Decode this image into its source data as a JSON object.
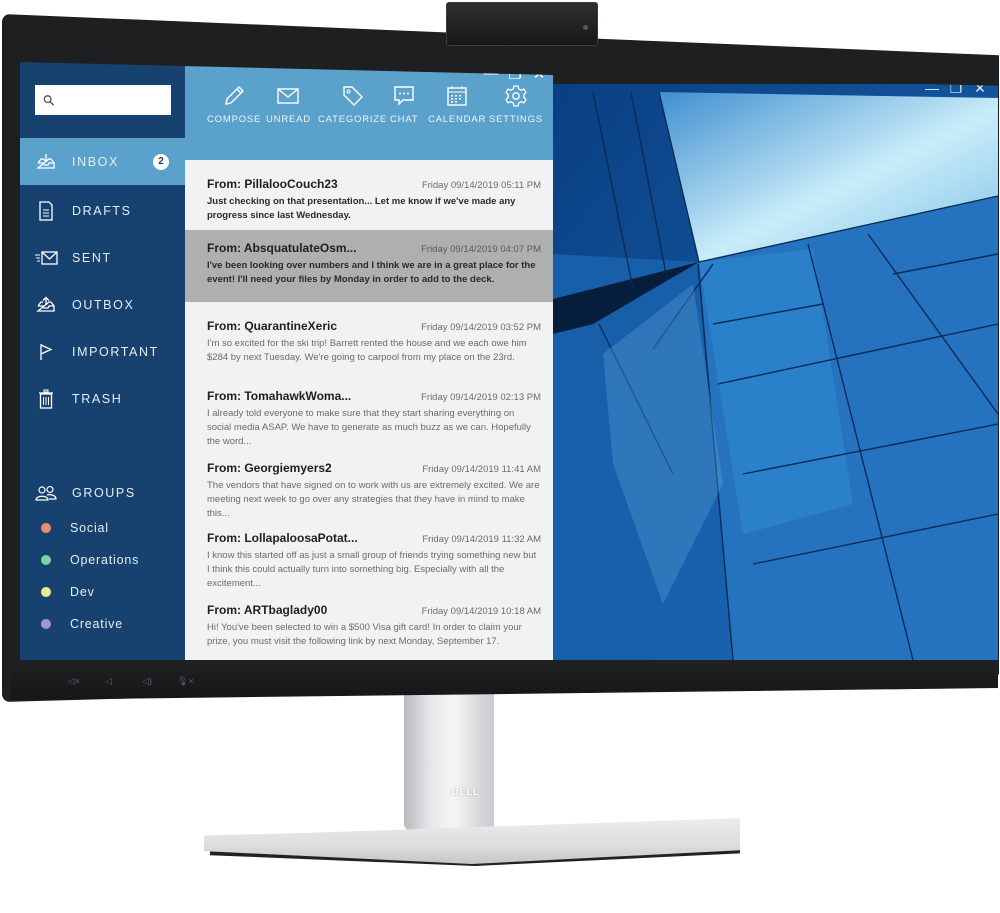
{
  "device": {
    "brand_logo": "DELL",
    "chin_buttons": [
      {
        "icon": "speaker-mute-icon",
        "glyph": "◁×"
      },
      {
        "icon": "speaker-low-icon",
        "glyph": "◁"
      },
      {
        "icon": "speaker-high-icon",
        "glyph": "◁)"
      },
      {
        "icon": "mic-mute-icon",
        "glyph": "🎙×"
      }
    ]
  },
  "mail_app": {
    "window_controls": {
      "minimize": "—",
      "restore": "❐",
      "close": "✕"
    },
    "search": {
      "placeholder": "",
      "value": "",
      "icon": "search-icon"
    },
    "nav": [
      {
        "label": "INBOX",
        "icon": "inbox-icon",
        "badge": "2",
        "active": true
      },
      {
        "label": "DRAFTS",
        "icon": "drafts-icon"
      },
      {
        "label": "SENT",
        "icon": "sent-icon"
      },
      {
        "label": "OUTBOX",
        "icon": "outbox-icon"
      },
      {
        "label": "IMPORTANT",
        "icon": "flag-icon"
      },
      {
        "label": "TRASH",
        "icon": "trash-icon"
      }
    ],
    "groups": {
      "label": "GROUPS",
      "icon": "groups-icon",
      "items": [
        {
          "label": "Social",
          "color": "#f08b74"
        },
        {
          "label": "Operations",
          "color": "#7ed0ac"
        },
        {
          "label": "Dev",
          "color": "#e8ec8a"
        },
        {
          "label": "Creative",
          "color": "#a393cf"
        }
      ]
    },
    "toolbar": [
      {
        "label": "COMPOSE",
        "icon": "pencil-icon"
      },
      {
        "label": "UNREAD",
        "icon": "envelope-icon"
      },
      {
        "label": "CATEGORIZE",
        "icon": "tag-icon"
      },
      {
        "label": "CHAT",
        "icon": "chat-icon"
      },
      {
        "label": "CALENDAR",
        "icon": "calendar-icon"
      },
      {
        "label": "SETTINGS",
        "icon": "gear-icon"
      }
    ],
    "messages": [
      {
        "from": "From: PillalooCouch23",
        "date": "Friday 09/14/2019 05:11 PM",
        "body": "Just checking on that presentation... Let me know if we've made any progress since last Wednesday.",
        "unread": true
      },
      {
        "from": "From: AbsquatulateOsm...",
        "date": "Friday 09/14/2019 04:07 PM",
        "body": "I've been looking over numbers and I think we are in a great place for the event! I'll need your files by Monday in order to add to the deck.",
        "unread": true,
        "selected": true
      },
      {
        "from": "From: QuarantineXeric",
        "date": "Friday 09/14/2019 03:52 PM",
        "body": "I'm so excited for the ski trip! Barrett rented the house and we each owe him $284 by next Tuesday. We're going to carpool from my place on the 23rd."
      },
      {
        "from": "From: TomahawkWoma...",
        "date": "Friday 09/14/2019 02:13 PM",
        "body": "I already told everyone to make sure that they start sharing everything on social media ASAP. We have to generate as much buzz as we can. Hopefully the word..."
      },
      {
        "from": "From: Georgiemyers2",
        "date": "Friday 09/14/2019 11:41 AM",
        "body": "The vendors that have signed on to work with us are extremely excited. We are meeting next week to go over any strategies that they have in mind to make this..."
      },
      {
        "from": "From: LollapaloosaPotat...",
        "date": "Friday 09/14/2019 11:32 AM",
        "body": "I know this started off as just a small group of friends trying something new but I think this could actually turn into something big. Especially with all the excitement..."
      },
      {
        "from": "From: ARTbaglady00",
        "date": "Friday 09/14/2019 10:18 AM",
        "body": "Hi! You've been selected to win a $500 Visa gift card! In order to claim your prize, you must visit the following link by next Monday, September 17."
      }
    ]
  },
  "desktop_window": {
    "window_controls": {
      "minimize": "—",
      "restore": "❐",
      "close": "✕"
    },
    "wallpaper": "blue-geometric-architecture"
  },
  "colors": {
    "sidebar": "#17416f",
    "accent": "#5aa2cc",
    "list_bg": "#f1f2f3",
    "selected_row": "#aeafb1"
  }
}
